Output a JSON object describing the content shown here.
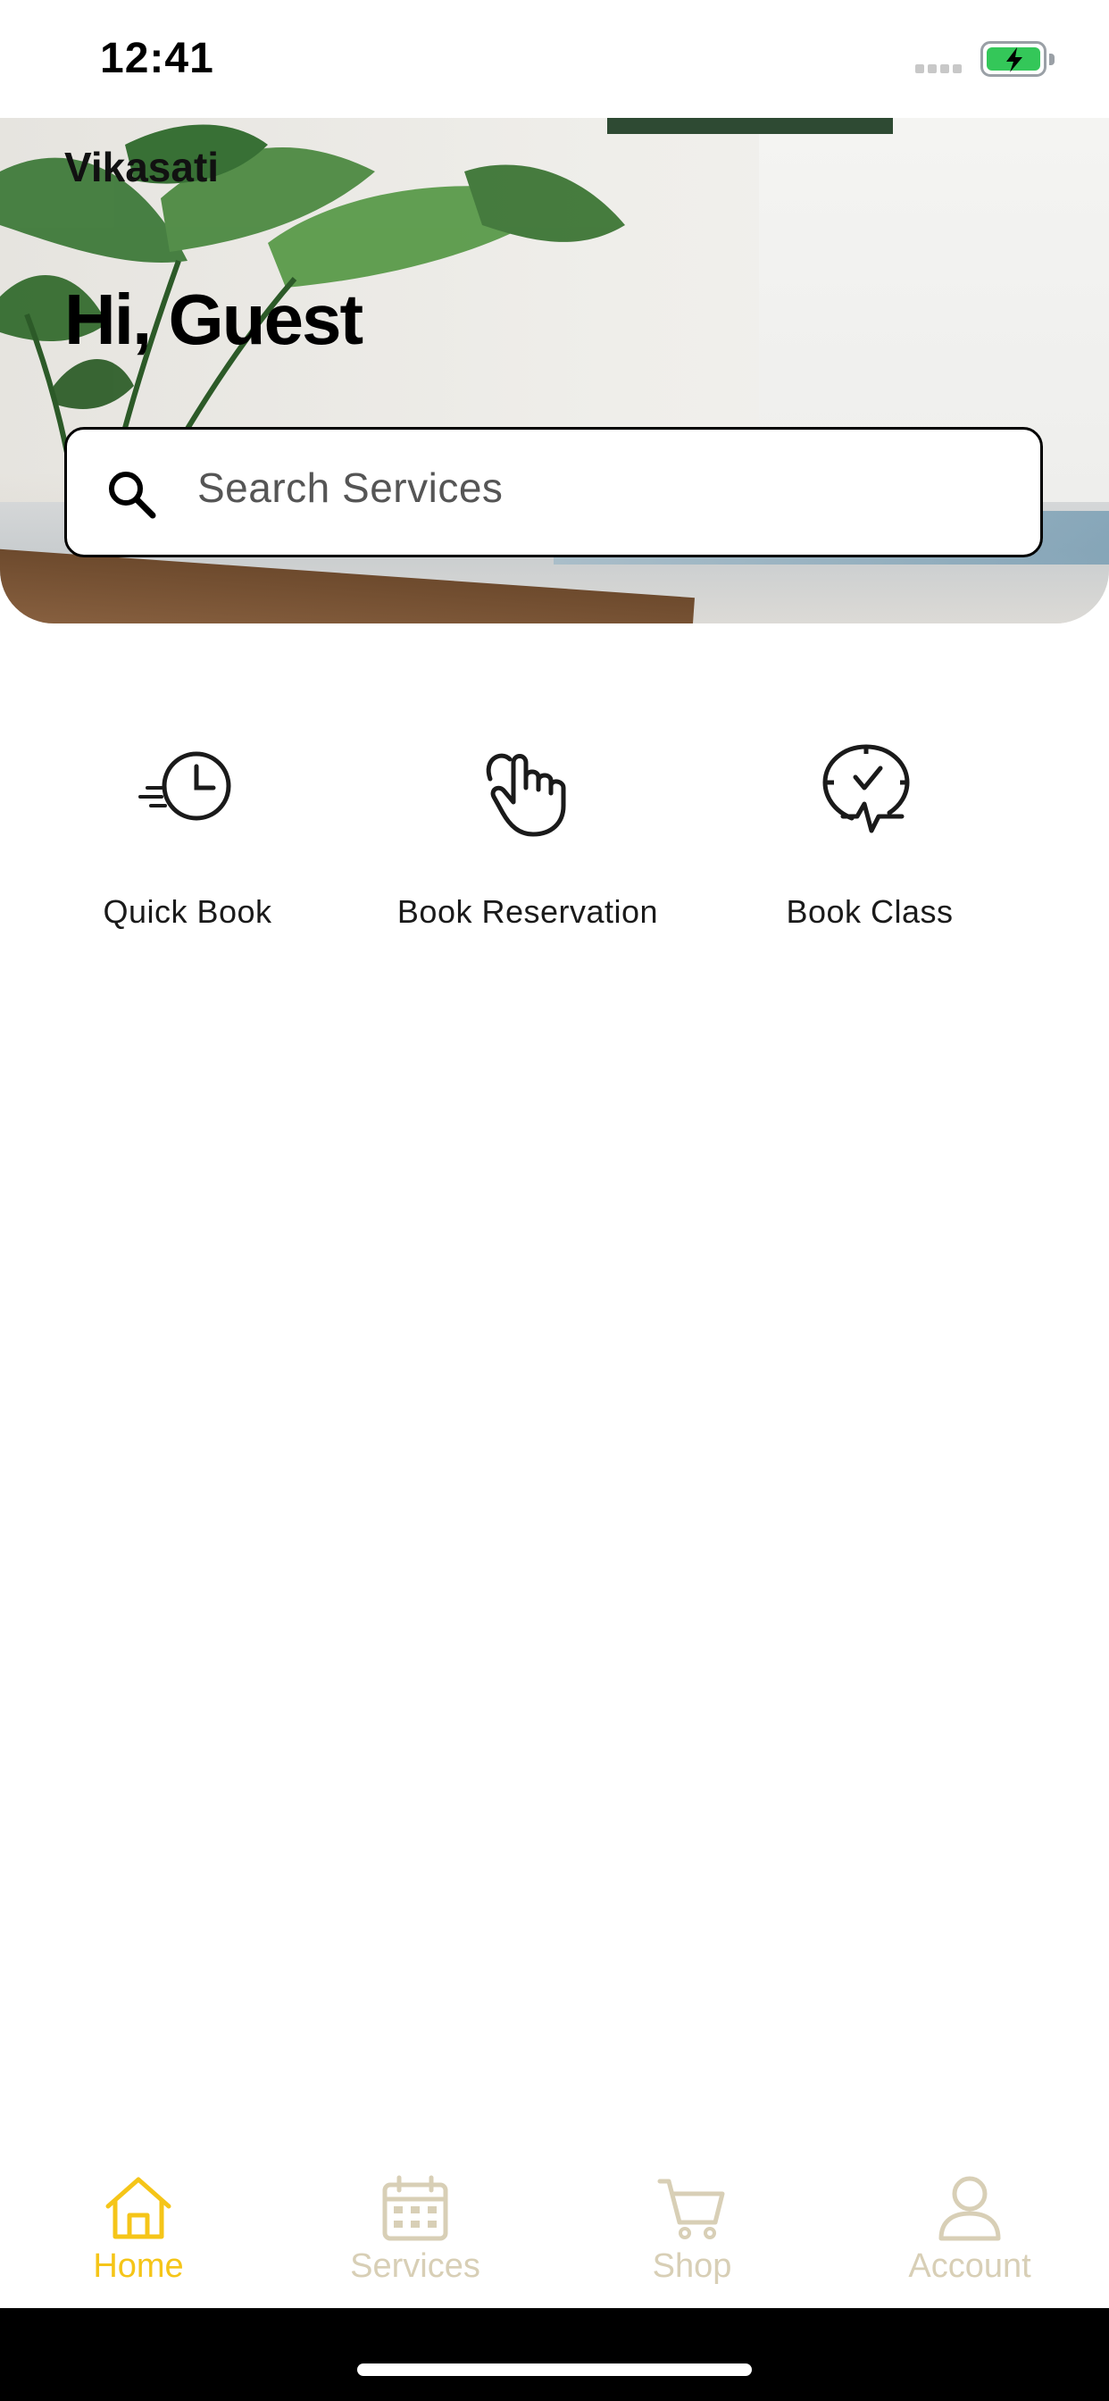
{
  "status_bar": {
    "time": "12:41"
  },
  "hero": {
    "brand": "Vikasati",
    "greeting": "Hi, Guest",
    "search": {
      "placeholder": "Search Services",
      "icon": "search-icon"
    }
  },
  "actions": [
    {
      "label": "Quick Book",
      "icon": "fast-clock-icon"
    },
    {
      "label": "Book Reservation",
      "icon": "tap-hand-icon"
    },
    {
      "label": "Book Class",
      "icon": "clock-pulse-icon"
    }
  ],
  "tab_bar": {
    "active_color": "#F5C518",
    "inactive_color": "#D8CFB6",
    "tabs": [
      {
        "label": "Home",
        "icon": "home-icon",
        "active": true
      },
      {
        "label": "Services",
        "icon": "calendar-icon",
        "active": false
      },
      {
        "label": "Shop",
        "icon": "cart-icon",
        "active": false
      },
      {
        "label": "Account",
        "icon": "user-icon",
        "active": false
      }
    ]
  }
}
